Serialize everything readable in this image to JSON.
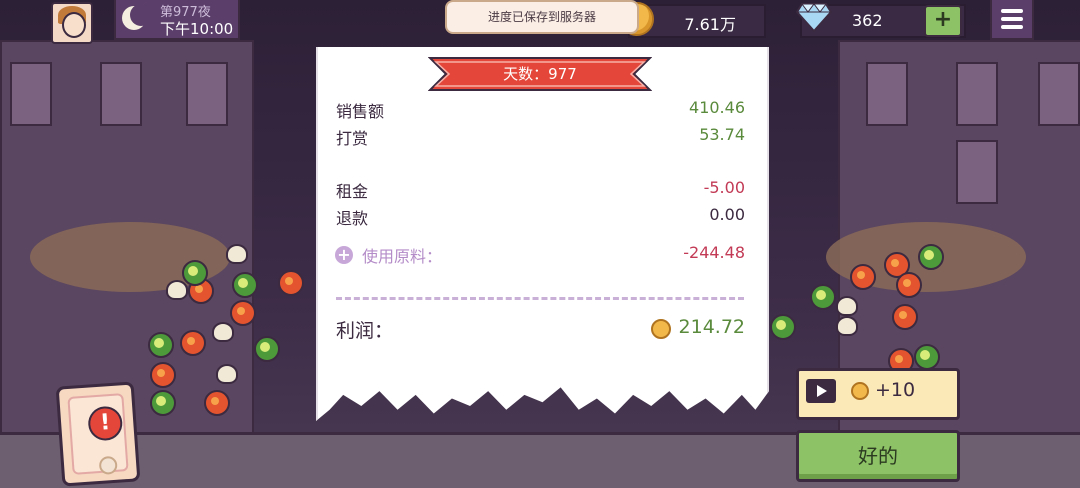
{
  "hud": {
    "night_label": "第977夜",
    "time": "下午10:00",
    "save_toast": "进度已保存到服务器",
    "coins": "7.61万",
    "gems": "362",
    "add_label": "+"
  },
  "receipt": {
    "day_banner": "天数：977",
    "sales_label": "销售额",
    "sales_value": "410.46",
    "tips_label": "打赏",
    "tips_value": "53.74",
    "rent_label": "租金",
    "rent_value": "-5.00",
    "refund_label": "退款",
    "refund_value": "0.00",
    "ingredients_label": "使用原料：",
    "ingredients_value": "-244.48",
    "profit_label": "利润：",
    "profit_value": "214.72"
  },
  "actions": {
    "ad_bonus": "+10",
    "ok_label": "好的"
  },
  "alert": {
    "mark": "!"
  },
  "colors": {
    "positive": "#5a8a3c",
    "negative": "#c23a55",
    "banner": "#e4473a",
    "ok_button": "#8dc266"
  }
}
